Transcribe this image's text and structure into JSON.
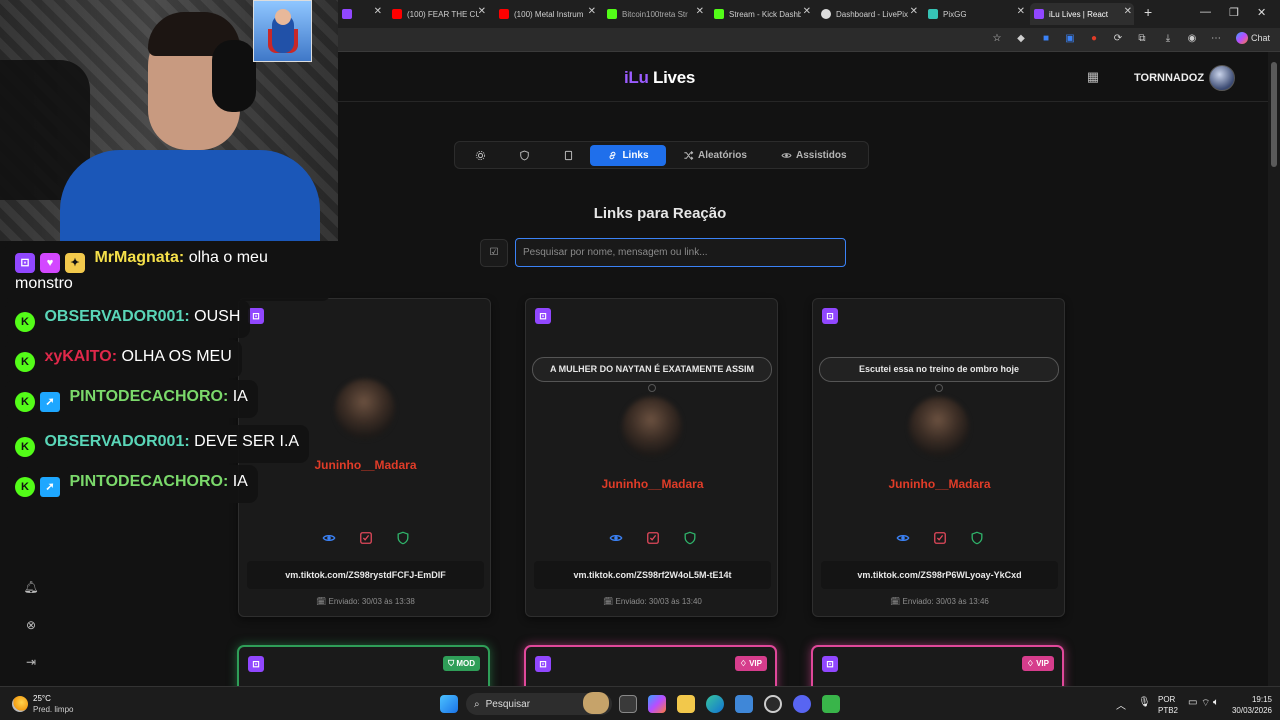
{
  "browser": {
    "tabs": [
      {
        "label": "",
        "color": "#9147ff"
      },
      {
        "label": "(100) FEAR THE CU",
        "color": "#ff0000"
      },
      {
        "label": "(100) Metal Instrum",
        "color": "#ff0000"
      },
      {
        "label": "Bitcoin100treta Str",
        "color": "#53fc18"
      },
      {
        "label": "Stream - Kick Dashb",
        "color": "#53fc18"
      },
      {
        "label": "Dashboard - LivePix",
        "color": "#dddddd"
      },
      {
        "label": "PixGG",
        "color": "#36c3b5"
      },
      {
        "label": "iLu Lives | React",
        "color": "#9147ff"
      }
    ],
    "chat_label": "Chat"
  },
  "header": {
    "logo_part1": "iLu",
    "logo_part2": "Lives",
    "username": "TORNNADOZ"
  },
  "nav": {
    "tabs": [
      {
        "label": "",
        "icon": "gear-icon"
      },
      {
        "label": "",
        "icon": "shield-icon"
      },
      {
        "label": "",
        "icon": "bookmark-icon"
      },
      {
        "label": "Links",
        "icon": "link-icon",
        "active": true
      },
      {
        "label": "Aleatórios",
        "icon": "shuffle-icon"
      },
      {
        "label": "Assistidos",
        "icon": "eye-icon"
      }
    ]
  },
  "main": {
    "title": "Links para Reação",
    "search_placeholder": "Pesquisar por nome, mensagem ou link..."
  },
  "cards": [
    {
      "author": "Juninho__Madara",
      "message": "",
      "link": "vm.tiktok.com/ZS98rystdFCFJ-EmDIF",
      "sent": "Enviado: 30/03 às 13:38"
    },
    {
      "author": "Juninho__Madara",
      "message": "A MULHER DO NAYTAN É EXATAMENTE ASSIM",
      "link": "vm.tiktok.com/ZS98rf2W4oL5M-tE14t",
      "sent": "Enviado: 30/03 às 13:40"
    },
    {
      "author": "Juninho__Madara",
      "message": "Escutei essa no treino de ombro hoje",
      "link": "vm.tiktok.com/ZS98rP6WLyoay-YkCxd",
      "sent": "Enviado: 30/03 às 13:46"
    }
  ],
  "cards_row2": [
    {
      "badge": "MOD",
      "type": "mod"
    },
    {
      "badge": "VIP",
      "type": "vip"
    },
    {
      "badge": "VIP",
      "type": "vip"
    }
  ],
  "overlay_chat": [
    {
      "name": "MrMagnata:",
      "text": "olha o meu monstro",
      "name_color": "#f5e04a"
    },
    {
      "name": "OBSERVADOR001:",
      "text": "OUSH",
      "name_color": "#5ad6b8"
    },
    {
      "name": "xyKAITO:",
      "text": "OLHA OS MEU",
      "name_color": "#e0284a"
    },
    {
      "name": "PINTODECACHORO:",
      "text": "IA",
      "name_color": "#7bd96b"
    },
    {
      "name": "OBSERVADOR001:",
      "text": "DEVE SER I.A",
      "name_color": "#5ad6b8"
    },
    {
      "name": "PINTODECACHORO:",
      "text": "IA",
      "name_color": "#7bd96b"
    }
  ],
  "taskbar": {
    "temperature": "25°C",
    "weather": "Pred. limpo",
    "search_label": "Pesquisar",
    "lang": "POR",
    "layout": "PTB2",
    "time": "19:15",
    "date": "30/03/2026"
  }
}
